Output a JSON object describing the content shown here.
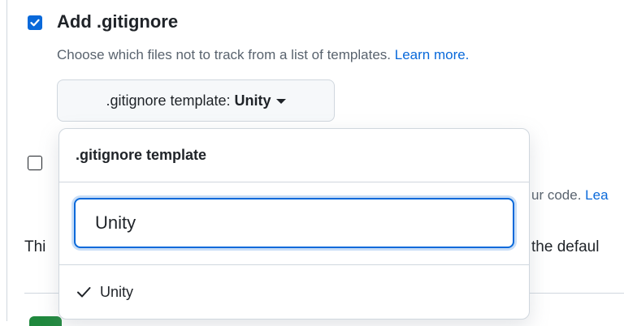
{
  "gitignore": {
    "checked": true,
    "title": "Add .gitignore",
    "description": "Choose which files not to track from a list of templates.",
    "learn_more": "Learn more.",
    "button_prefix": ".gitignore template:",
    "button_value": "Unity"
  },
  "dropdown": {
    "header": ".gitignore template",
    "filter_value": "Unity",
    "options": [
      {
        "label": "Unity",
        "selected": true
      }
    ]
  },
  "license": {
    "checked": false,
    "partial_description": "ur code.",
    "partial_learn": "Lea"
  },
  "footer_partial": {
    "left": "Thi",
    "right": "the defaul"
  },
  "colors": {
    "accent": "#0969da",
    "border": "#d0d7de",
    "muted": "#59636e"
  }
}
